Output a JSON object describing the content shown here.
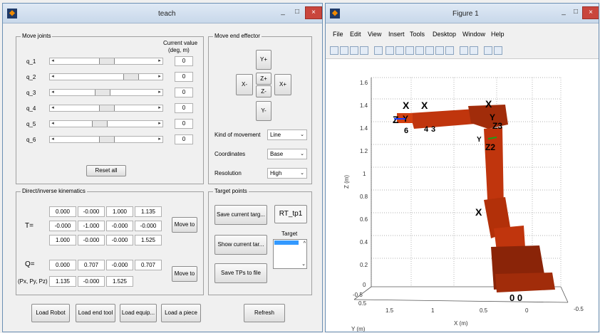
{
  "teach": {
    "title": "teach",
    "controls": {
      "min": "_",
      "max": "□",
      "close": "×"
    },
    "move_joints": {
      "legend": "Move joints",
      "current_value_header_1": "Current value",
      "current_value_header_2": "(deg, m)",
      "joints": [
        {
          "label": "q_1",
          "value": "0",
          "position": 0.5
        },
        {
          "label": "q_2",
          "value": "0",
          "position": 0.78
        },
        {
          "label": "q_3",
          "value": "0",
          "position": 0.45
        },
        {
          "label": "q_4",
          "value": "0",
          "position": 0.5
        },
        {
          "label": "q_5",
          "value": "0",
          "position": 0.42
        },
        {
          "label": "q_6",
          "value": "0",
          "position": 0.5
        }
      ],
      "reset_label": "Reset all"
    },
    "move_end_effector": {
      "legend": "Move end effector",
      "y_plus": "Y+",
      "y_minus": "Y-",
      "x_minus": "X-",
      "x_plus": "X+",
      "z_plus": "Z+",
      "z_minus": "Z-",
      "kind_label": "Kind of movement",
      "kind_value": "Line",
      "coords_label": "Coordinates",
      "coords_value": "Base",
      "res_label": "Resolution",
      "res_value": "High"
    },
    "kinematics": {
      "legend": "Direct/inverse kinematics",
      "t_label": "T=",
      "t_rows": [
        [
          "0.000",
          "-0.000",
          "1.000",
          "1.135"
        ],
        [
          "-0.000",
          "-1.000",
          "-0.000",
          "-0.000"
        ],
        [
          "1.000",
          "-0.000",
          "-0.000",
          "1.525"
        ]
      ],
      "move_to_1": "Move to",
      "q_label": "Q=",
      "q_values": [
        "0.000",
        "0.707",
        "-0.000",
        "0.707"
      ],
      "p_label": "(Px, Py, Pz)",
      "p_values": [
        "1.135",
        "-0.000",
        "1.525"
      ],
      "move_to_2": "Move to"
    },
    "target_points": {
      "legend": "Target points",
      "save_current": "Save current targ...",
      "name": "RT_tp1",
      "target_label": "Target",
      "show_current": "Show current tar...",
      "save_tps": "Save TPs to file"
    },
    "bottom": {
      "load_robot": "Load Robot",
      "load_tool": "Load end tool",
      "load_equip": "Load equip...",
      "load_piece": "Load a piece",
      "refresh": "Refresh"
    }
  },
  "figure": {
    "title": "Figure 1",
    "controls": {
      "min": "_",
      "max": "□",
      "close": "×"
    },
    "menu": [
      "File",
      "Edit",
      "View",
      "Insert",
      "Tools",
      "Desktop",
      "Window",
      "Help"
    ],
    "z_ticks": [
      "1.6",
      "1.4",
      "1.2",
      "1",
      "0.8",
      "0.6",
      "0.4",
      "0.2",
      "0"
    ],
    "z_label": "Z (m)",
    "x_ticks": [
      "0.5",
      "0",
      "-0.5"
    ],
    "x_label": "X (m)",
    "y_ticks": [
      "-0.5",
      "0.5",
      "1.5",
      "1",
      "0.5",
      "0"
    ],
    "y_label": "Y (m)",
    "frame_labels": {
      "x1": "X",
      "x2": "X",
      "x3": "X",
      "x4": "X",
      "z1": "Z",
      "y1": "Y",
      "y2": "Y",
      "z3": "Z3",
      "z2": "Z2",
      "y3": "Y",
      "n6": "6",
      "n4": "4",
      "n3": "3",
      "oo": "0 0"
    },
    "colors": {
      "robot": "#c0350d",
      "robot_dark": "#8a2408",
      "bg": "#ffffff"
    }
  }
}
